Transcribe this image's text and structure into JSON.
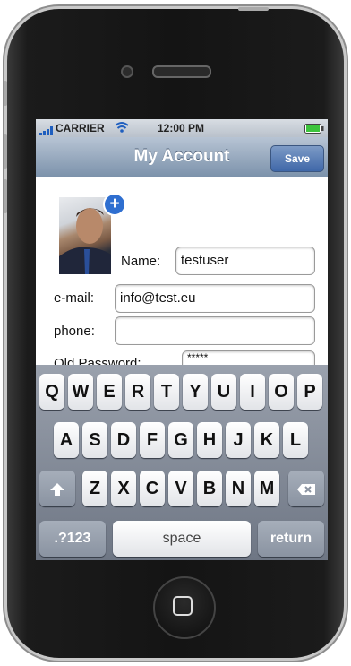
{
  "status": {
    "carrier": "CARRIER",
    "time": "12:00 PM"
  },
  "nav": {
    "title": "My Account",
    "save": "Save"
  },
  "form": {
    "name_label": "Name:",
    "name_value": "testuser",
    "email_label": "e-mail:",
    "email_value": "info@test.eu",
    "phone_label": "phone:",
    "phone_value": "",
    "oldpw_label": "Old Password:",
    "oldpw_value": "*****",
    "add_photo": "+"
  },
  "keyboard": {
    "row1": [
      "Q",
      "W",
      "E",
      "R",
      "T",
      "Y",
      "U",
      "I",
      "O",
      "P"
    ],
    "row2": [
      "A",
      "S",
      "D",
      "F",
      "G",
      "H",
      "J",
      "K",
      "L"
    ],
    "row3": [
      "Z",
      "X",
      "C",
      "V",
      "B",
      "N",
      "M"
    ],
    "numbers": ".?123",
    "space": "space",
    "return": "return"
  },
  "colors": {
    "nav_bar": "#7c92ab",
    "save_button": "#3f67a8",
    "add_badge": "#2f6fd0"
  }
}
